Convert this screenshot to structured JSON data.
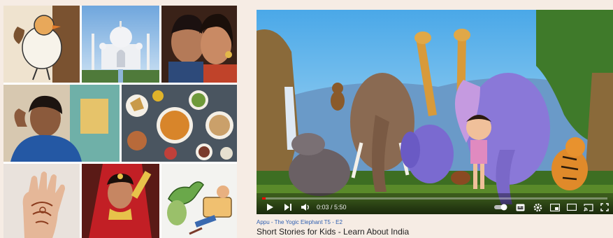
{
  "collage": {
    "tiles": [
      {
        "name": "cartoon-bird-tile",
        "desc": "cartoon"
      },
      {
        "name": "taj-mahal-tile",
        "desc": "taj mahal"
      },
      {
        "name": "couple-portrait-tile",
        "desc": "couple"
      },
      {
        "name": "woman-portrait-tile",
        "desc": "woman"
      },
      {
        "name": "food-spread-tile",
        "desc": "food"
      },
      {
        "name": "henna-hand-tile",
        "desc": "henna"
      },
      {
        "name": "bride-tile",
        "desc": "bride"
      },
      {
        "name": "cartoon-turtle-tile",
        "desc": "turtle"
      }
    ]
  },
  "player": {
    "time": "0:03 / 5:50",
    "progress_fraction": 0.01,
    "icons": [
      "play-icon",
      "next-icon",
      "volume-icon",
      "autoplay-toggle-icon",
      "subtitles-icon",
      "settings-icon",
      "miniplayer-icon",
      "theater-icon",
      "cast-icon",
      "fullscreen-icon"
    ]
  },
  "video": {
    "channel": "Appu - The Yogic Elephant  T5 - E2",
    "title": "Short Stories for Kids - Learn About India"
  },
  "colors": {
    "sky": "#7fc4ea",
    "accent_red": "#ff0000",
    "link": "#2f5fb0"
  }
}
